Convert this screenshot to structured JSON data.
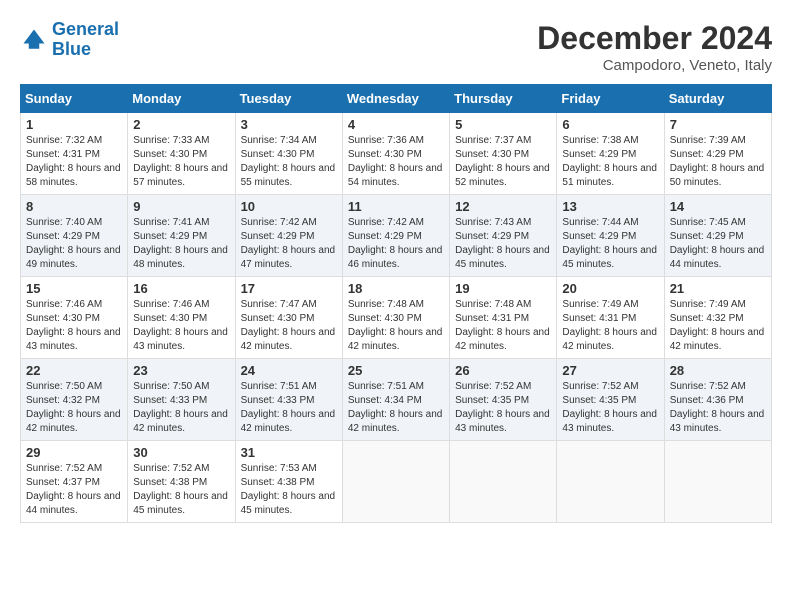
{
  "logo": {
    "line1": "General",
    "line2": "Blue"
  },
  "title": "December 2024",
  "location": "Campodoro, Veneto, Italy",
  "days": [
    "Sunday",
    "Monday",
    "Tuesday",
    "Wednesday",
    "Thursday",
    "Friday",
    "Saturday"
  ],
  "weeks": [
    [
      {
        "day": "1",
        "sunrise": "7:32 AM",
        "sunset": "4:31 PM",
        "daylight": "8 hours and 58 minutes."
      },
      {
        "day": "2",
        "sunrise": "7:33 AM",
        "sunset": "4:30 PM",
        "daylight": "8 hours and 57 minutes."
      },
      {
        "day": "3",
        "sunrise": "7:34 AM",
        "sunset": "4:30 PM",
        "daylight": "8 hours and 55 minutes."
      },
      {
        "day": "4",
        "sunrise": "7:36 AM",
        "sunset": "4:30 PM",
        "daylight": "8 hours and 54 minutes."
      },
      {
        "day": "5",
        "sunrise": "7:37 AM",
        "sunset": "4:30 PM",
        "daylight": "8 hours and 52 minutes."
      },
      {
        "day": "6",
        "sunrise": "7:38 AM",
        "sunset": "4:29 PM",
        "daylight": "8 hours and 51 minutes."
      },
      {
        "day": "7",
        "sunrise": "7:39 AM",
        "sunset": "4:29 PM",
        "daylight": "8 hours and 50 minutes."
      }
    ],
    [
      {
        "day": "8",
        "sunrise": "7:40 AM",
        "sunset": "4:29 PM",
        "daylight": "8 hours and 49 minutes."
      },
      {
        "day": "9",
        "sunrise": "7:41 AM",
        "sunset": "4:29 PM",
        "daylight": "8 hours and 48 minutes."
      },
      {
        "day": "10",
        "sunrise": "7:42 AM",
        "sunset": "4:29 PM",
        "daylight": "8 hours and 47 minutes."
      },
      {
        "day": "11",
        "sunrise": "7:42 AM",
        "sunset": "4:29 PM",
        "daylight": "8 hours and 46 minutes."
      },
      {
        "day": "12",
        "sunrise": "7:43 AM",
        "sunset": "4:29 PM",
        "daylight": "8 hours and 45 minutes."
      },
      {
        "day": "13",
        "sunrise": "7:44 AM",
        "sunset": "4:29 PM",
        "daylight": "8 hours and 45 minutes."
      },
      {
        "day": "14",
        "sunrise": "7:45 AM",
        "sunset": "4:29 PM",
        "daylight": "8 hours and 44 minutes."
      }
    ],
    [
      {
        "day": "15",
        "sunrise": "7:46 AM",
        "sunset": "4:30 PM",
        "daylight": "8 hours and 43 minutes."
      },
      {
        "day": "16",
        "sunrise": "7:46 AM",
        "sunset": "4:30 PM",
        "daylight": "8 hours and 43 minutes."
      },
      {
        "day": "17",
        "sunrise": "7:47 AM",
        "sunset": "4:30 PM",
        "daylight": "8 hours and 42 minutes."
      },
      {
        "day": "18",
        "sunrise": "7:48 AM",
        "sunset": "4:30 PM",
        "daylight": "8 hours and 42 minutes."
      },
      {
        "day": "19",
        "sunrise": "7:48 AM",
        "sunset": "4:31 PM",
        "daylight": "8 hours and 42 minutes."
      },
      {
        "day": "20",
        "sunrise": "7:49 AM",
        "sunset": "4:31 PM",
        "daylight": "8 hours and 42 minutes."
      },
      {
        "day": "21",
        "sunrise": "7:49 AM",
        "sunset": "4:32 PM",
        "daylight": "8 hours and 42 minutes."
      }
    ],
    [
      {
        "day": "22",
        "sunrise": "7:50 AM",
        "sunset": "4:32 PM",
        "daylight": "8 hours and 42 minutes."
      },
      {
        "day": "23",
        "sunrise": "7:50 AM",
        "sunset": "4:33 PM",
        "daylight": "8 hours and 42 minutes."
      },
      {
        "day": "24",
        "sunrise": "7:51 AM",
        "sunset": "4:33 PM",
        "daylight": "8 hours and 42 minutes."
      },
      {
        "day": "25",
        "sunrise": "7:51 AM",
        "sunset": "4:34 PM",
        "daylight": "8 hours and 42 minutes."
      },
      {
        "day": "26",
        "sunrise": "7:52 AM",
        "sunset": "4:35 PM",
        "daylight": "8 hours and 43 minutes."
      },
      {
        "day": "27",
        "sunrise": "7:52 AM",
        "sunset": "4:35 PM",
        "daylight": "8 hours and 43 minutes."
      },
      {
        "day": "28",
        "sunrise": "7:52 AM",
        "sunset": "4:36 PM",
        "daylight": "8 hours and 43 minutes."
      }
    ],
    [
      {
        "day": "29",
        "sunrise": "7:52 AM",
        "sunset": "4:37 PM",
        "daylight": "8 hours and 44 minutes."
      },
      {
        "day": "30",
        "sunrise": "7:52 AM",
        "sunset": "4:38 PM",
        "daylight": "8 hours and 45 minutes."
      },
      {
        "day": "31",
        "sunrise": "7:53 AM",
        "sunset": "4:38 PM",
        "daylight": "8 hours and 45 minutes."
      },
      null,
      null,
      null,
      null
    ]
  ]
}
